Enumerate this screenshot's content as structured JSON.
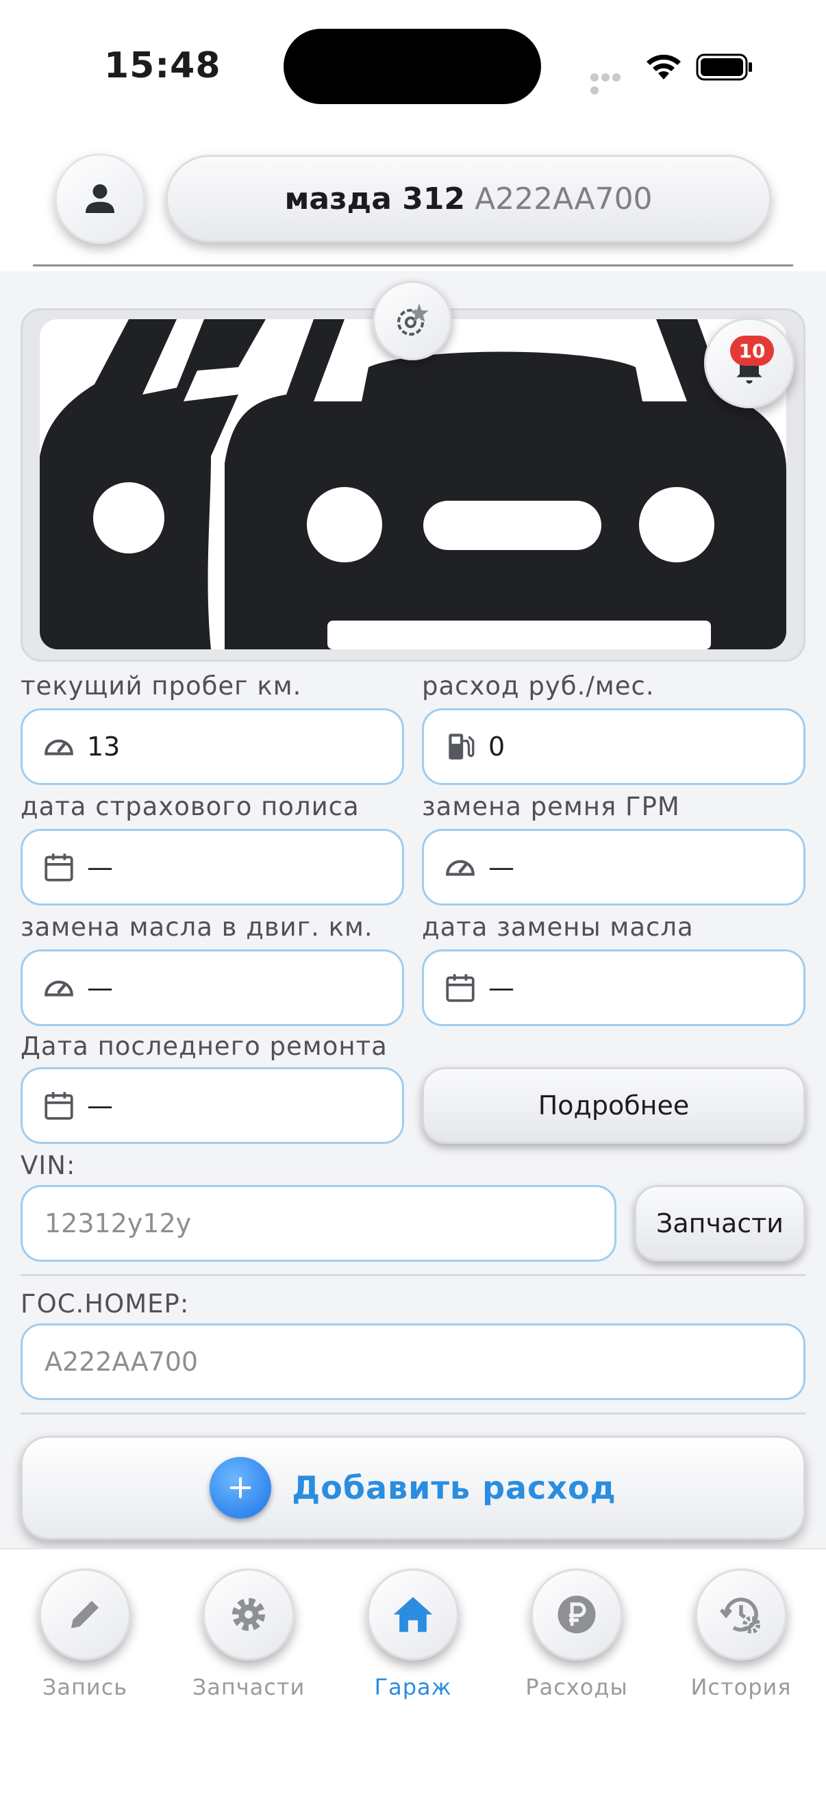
{
  "status_bar": {
    "time": "15:48"
  },
  "header": {
    "car_model": "мазда 312",
    "car_plate": "A222AA700"
  },
  "notifications": {
    "count": "10"
  },
  "fields": {
    "mileage": {
      "label": "текущий пробег км.",
      "value": "13"
    },
    "expense": {
      "label": "расход руб./мес.",
      "value": "0"
    },
    "insurance": {
      "label": "дата страхового полиса",
      "value": "—"
    },
    "timing_belt": {
      "label": "замена ремня ГРМ",
      "value": "—"
    },
    "oil_km": {
      "label": "замена масла в двиг. км.",
      "value": "—"
    },
    "oil_date": {
      "label": "дата замены масла",
      "value": "—"
    },
    "last_repair": {
      "label": "Дата последнего ремонта",
      "value": "—"
    },
    "vin": {
      "label": "VIN:",
      "value": "12312y12y"
    },
    "plate": {
      "label": "ГОС.НОМЕР:",
      "value": "A222AA700"
    }
  },
  "buttons": {
    "details": "Подробнее",
    "parts": "Запчасти",
    "add_expense": "Добавить расход"
  },
  "nav": [
    {
      "label": "Запись",
      "icon": "pencil-icon"
    },
    {
      "label": "Запчасти",
      "icon": "gear-icon"
    },
    {
      "label": "Гараж",
      "icon": "home-icon",
      "active": true
    },
    {
      "label": "Расходы",
      "icon": "ruble-icon"
    },
    {
      "label": "История",
      "icon": "history-icon"
    }
  ],
  "colors": {
    "accent": "#2a8de0",
    "field_border": "#9fcdf0",
    "badge": "#e53935"
  }
}
